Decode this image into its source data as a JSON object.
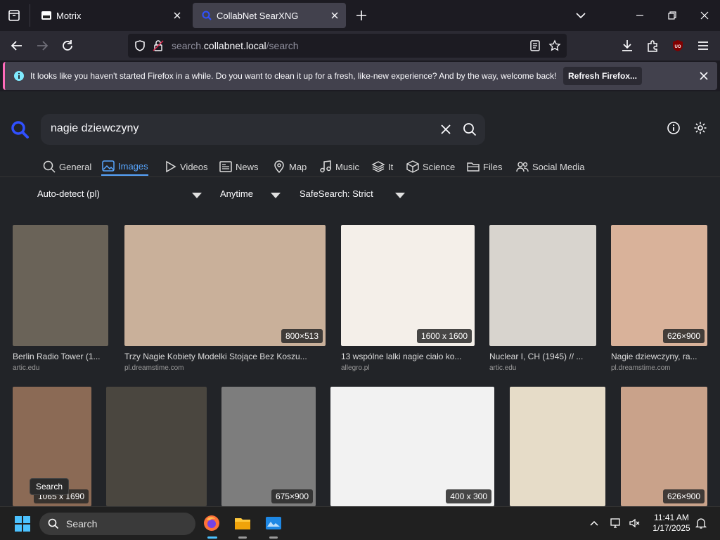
{
  "tabs": [
    {
      "title": "Motrix",
      "active": false
    },
    {
      "title": "CollabNet SearXNG",
      "active": true
    }
  ],
  "address": {
    "prefix": "search.",
    "domain": "collabnet.local",
    "path": "/search"
  },
  "notification": {
    "message": "It looks like you haven't started Firefox in a while. Do you want to clean it up for a fresh, like-new experience? And by the way, welcome back!",
    "button": "Refresh Firefox..."
  },
  "search": {
    "query": "nagie dziewczyny"
  },
  "categories": [
    {
      "label": "General",
      "icon": "search-icon",
      "active": false
    },
    {
      "label": "Images",
      "icon": "image-icon",
      "active": true
    },
    {
      "label": "Videos",
      "icon": "play-icon",
      "active": false
    },
    {
      "label": "News",
      "icon": "newspaper-icon",
      "active": false
    },
    {
      "label": "Map",
      "icon": "map-pin-icon",
      "active": false
    },
    {
      "label": "Music",
      "icon": "music-note-icon",
      "active": false
    },
    {
      "label": "It",
      "icon": "layers-icon",
      "active": false
    },
    {
      "label": "Science",
      "icon": "cube-icon",
      "active": false
    },
    {
      "label": "Files",
      "icon": "folder-icon",
      "active": false
    },
    {
      "label": "Social Media",
      "icon": "people-icon",
      "active": false
    }
  ],
  "filters": {
    "language": "Auto-detect (pl)",
    "time": "Anytime",
    "safesearch": "SafeSearch: Strict"
  },
  "results_row1": [
    {
      "title": "Berlin Radio Tower (1...",
      "source": "artic.edu",
      "resolution": "",
      "color": "#6a6358"
    },
    {
      "title": "Trzy Nagie Kobiety Modelki Stojące Bez Koszu...",
      "source": "pl.dreamstime.com",
      "resolution": "800×513",
      "color": "#c9b09a"
    },
    {
      "title": "13 wspólne lalki nagie ciało ko...",
      "source": "allegro.pl",
      "resolution": "1600 x 1600",
      "color": "#f4efe9"
    },
    {
      "title": "Nuclear I, CH (1945) // ...",
      "source": "artic.edu",
      "resolution": "",
      "color": "#d8d4ce"
    },
    {
      "title": "Nagie dziewczyny, ra...",
      "source": "pl.dreamstime.com",
      "resolution": "626×900",
      "color": "#d9b29a"
    }
  ],
  "results_row2": [
    {
      "resolution": "1065 x 1690",
      "color": "#8b6a55"
    },
    {
      "resolution": "",
      "color": "#4a463f"
    },
    {
      "resolution": "675×900",
      "color": "#7d7d7d"
    },
    {
      "resolution": "400 x 300",
      "color": "#f2f2f2"
    },
    {
      "resolution": "",
      "color": "#e6dcc8"
    },
    {
      "resolution": "626×900",
      "color": "#c9a28a"
    }
  ],
  "tooltip": "Search",
  "taskbar": {
    "search_label": "Search",
    "time": "11:41 AM",
    "date": "1/17/2025"
  }
}
